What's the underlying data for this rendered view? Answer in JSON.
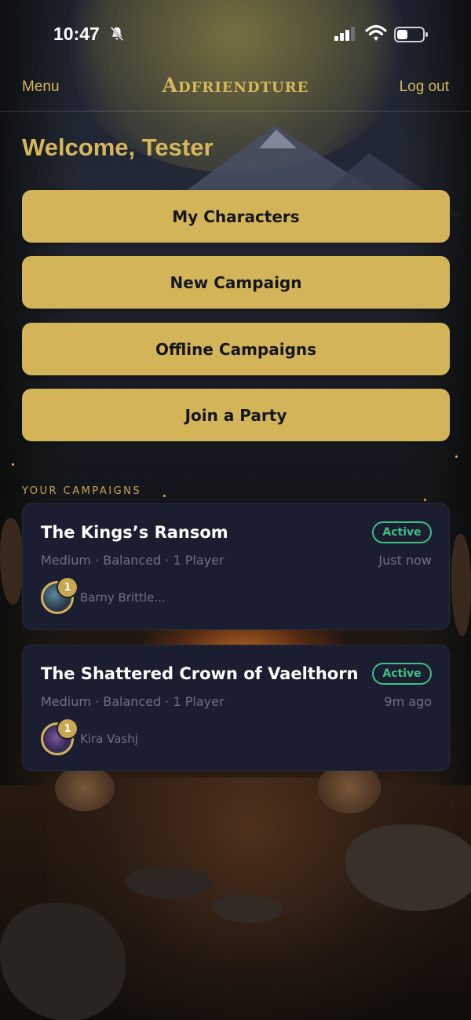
{
  "status_bar": {
    "time": "10:47",
    "icons": [
      "bell-off-icon",
      "signal-icon",
      "wifi-icon",
      "battery-icon"
    ]
  },
  "header": {
    "menu_label": "Menu",
    "app_title": "Adfriendture",
    "logout_label": "Log out"
  },
  "welcome": "Welcome, Tester",
  "actions": [
    {
      "label": "My Characters"
    },
    {
      "label": "New Campaign"
    },
    {
      "label": "Offline Campaigns"
    },
    {
      "label": "Join a Party"
    }
  ],
  "campaigns_section_label": "YOUR CAMPAIGNS",
  "campaigns": [
    {
      "title": "The Kings’s Ransom",
      "status": "Active",
      "meta": "Medium · Balanced · 1 Player",
      "time": "Just now",
      "player_count": "1",
      "player_name": "Barny Brittle..."
    },
    {
      "title": "The Shattered Crown of Vaelthorn",
      "status": "Active",
      "meta": "Medium · Balanced · 1 Player",
      "time": "9m ago",
      "player_count": "1",
      "player_name": "Kira Vashj"
    }
  ],
  "colors": {
    "accent_gold": "#d3b459",
    "card_bg": "#1b1d30",
    "active_green": "#3fbf86",
    "muted_text": "#6e7185"
  }
}
